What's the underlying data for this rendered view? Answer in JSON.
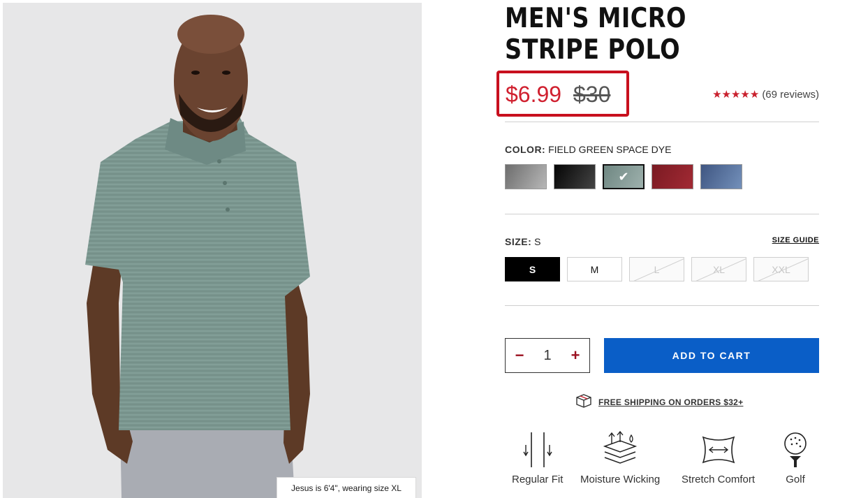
{
  "product": {
    "title": "MEN'S MICRO STRIPE POLO",
    "sale_price": "$6.99",
    "original_price": "$30",
    "rating_stars": 5,
    "reviews": "(69 reviews)",
    "photo_caption": "Jesus is 6'4\", wearing size XL"
  },
  "color": {
    "label": "COLOR:",
    "selected": "FIELD GREEN SPACE DYE",
    "swatches": [
      {
        "name": "gray",
        "hex": "#8d8d8d"
      },
      {
        "name": "black",
        "hex": "#1c1c1c"
      },
      {
        "name": "field green space dye",
        "hex": "#7c928d",
        "selected": true
      },
      {
        "name": "red",
        "hex": "#8c1e26"
      },
      {
        "name": "blue",
        "hex": "#4f6893"
      }
    ]
  },
  "size": {
    "label": "SIZE:",
    "selected": "S",
    "guide": "SIZE GUIDE",
    "options": [
      {
        "label": "S",
        "state": "selected"
      },
      {
        "label": "M",
        "state": "available"
      },
      {
        "label": "L",
        "state": "unavailable"
      },
      {
        "label": "XL",
        "state": "unavailable"
      },
      {
        "label": "XXL",
        "state": "unavailable"
      }
    ]
  },
  "cart": {
    "quantity": "1",
    "minus": "−",
    "plus": "+",
    "add_label": "ADD TO CART",
    "button_color": "#0a5ec7"
  },
  "shipping": {
    "text": "FREE SHIPPING ON ORDERS $32+",
    "icon": "box-icon"
  },
  "features": [
    {
      "label": "Regular Fit",
      "icon": "regular-fit-icon"
    },
    {
      "label": "Moisture Wicking",
      "icon": "moisture-wicking-icon"
    },
    {
      "label": "Stretch Comfort",
      "icon": "stretch-comfort-icon"
    },
    {
      "label": "Golf",
      "icon": "golf-icon"
    }
  ],
  "colors": {
    "sale": "#d0202f",
    "highlight_box": "#c8101e",
    "stars": "#c9202d"
  }
}
